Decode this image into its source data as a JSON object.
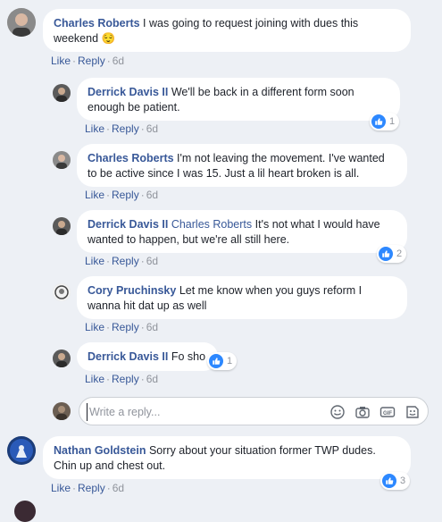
{
  "comments": [
    {
      "author": "Charles Roberts",
      "text": "I was going to request joining with dues this weekend",
      "emoji": "😌",
      "like": "Like",
      "reply": "Reply",
      "time": "6d"
    },
    {
      "author": "Derrick Davis II",
      "text": "We'll be back in a different form soon enough be patient.",
      "like": "Like",
      "reply": "Reply",
      "time": "6d",
      "reactions": "1"
    },
    {
      "author": "Charles Roberts",
      "text": "I'm not leaving the movement. I've wanted to be active since I was 15. Just a lil heart broken is all.",
      "like": "Like",
      "reply": "Reply",
      "time": "6d"
    },
    {
      "author": "Derrick Davis II",
      "mention": "Charles Roberts",
      "text": "It's not what I would have wanted to happen, but we're all still here.",
      "like": "Like",
      "reply": "Reply",
      "time": "6d",
      "reactions": "2"
    },
    {
      "author": "Cory Pruchinsky",
      "text": "Let me know when you guys reform I wanna hit dat up as well",
      "like": "Like",
      "reply": "Reply",
      "time": "6d"
    },
    {
      "author": "Derrick Davis II",
      "text": "Fo sho",
      "like": "Like",
      "reply": "Reply",
      "time": "6d",
      "reactions": "1"
    },
    {
      "author": "Nathan Goldstein",
      "text": "Sorry about your situation former TWP dudes. Chin up and chest out.",
      "like": "Like",
      "reply": "Reply",
      "time": "6d",
      "reactions": "3"
    }
  ],
  "reply_box": {
    "placeholder": "Write a reply..."
  },
  "icons": {
    "emoji": "smiley-icon",
    "camera": "camera-icon",
    "gif": "gif-icon",
    "sticker": "sticker-icon",
    "like": "like-thumb-icon"
  },
  "colors": {
    "accent": "#385898",
    "like_blue": "#2d88ff",
    "background": "#edf0f5"
  }
}
